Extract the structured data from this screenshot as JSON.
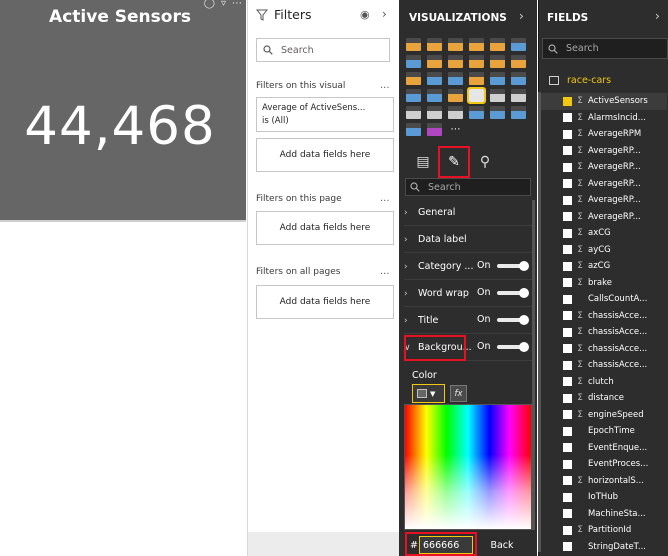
{
  "card": {
    "title": "Active Sensors",
    "value": "44,468",
    "toolbar_icons": [
      "pin-icon",
      "filter-icon",
      "more-icon"
    ]
  },
  "filters": {
    "header": "Filters",
    "search_placeholder": "Search",
    "visual_section": "Filters on this visual",
    "filter_card_line1": "Average of ActiveSens...",
    "filter_card_line2": "is (All)",
    "add_fields": "Add data fields here",
    "page_section": "Filters on this page",
    "all_section": "Filters on all pages",
    "more": "..."
  },
  "visualizations": {
    "header": "VISUALIZATIONS",
    "search_placeholder": "Search",
    "rows": [
      {
        "label": "General",
        "toggle": false
      },
      {
        "label": "Data label",
        "toggle": false
      },
      {
        "label": "Category ...",
        "toggle": true
      },
      {
        "label": "Word wrap",
        "toggle": true
      },
      {
        "label": "Title",
        "toggle": true
      },
      {
        "label": "Backgrou...",
        "toggle": true,
        "expanded": true
      }
    ],
    "on_label": "On",
    "color_label": "Color",
    "fx_label": "fx",
    "hex_value": "666666",
    "hash": "#",
    "back_label": "Back",
    "selected_color": "#666666"
  },
  "fields": {
    "header": "FIELDS",
    "search_placeholder": "Search",
    "table": "race-cars",
    "items": [
      {
        "name": "ActiveSensors",
        "checked": true,
        "sigma": true
      },
      {
        "name": "AlarmsIncid...",
        "checked": false,
        "sigma": true
      },
      {
        "name": "AverageRPM",
        "checked": false,
        "sigma": true
      },
      {
        "name": "AverageRP...",
        "checked": false,
        "sigma": true
      },
      {
        "name": "AverageRP...",
        "checked": false,
        "sigma": true
      },
      {
        "name": "AverageRP...",
        "checked": false,
        "sigma": true
      },
      {
        "name": "AverageRP...",
        "checked": false,
        "sigma": true
      },
      {
        "name": "AverageRP...",
        "checked": false,
        "sigma": true
      },
      {
        "name": "axCG",
        "checked": false,
        "sigma": true
      },
      {
        "name": "ayCG",
        "checked": false,
        "sigma": true
      },
      {
        "name": "azCG",
        "checked": false,
        "sigma": true
      },
      {
        "name": "brake",
        "checked": false,
        "sigma": true
      },
      {
        "name": "CallsCountA...",
        "checked": false,
        "sigma": false
      },
      {
        "name": "chassisAcce...",
        "checked": false,
        "sigma": true
      },
      {
        "name": "chassisAcce...",
        "checked": false,
        "sigma": true
      },
      {
        "name": "chassisAcce...",
        "checked": false,
        "sigma": true
      },
      {
        "name": "chassisAcce...",
        "checked": false,
        "sigma": true
      },
      {
        "name": "clutch",
        "checked": false,
        "sigma": true
      },
      {
        "name": "distance",
        "checked": false,
        "sigma": true
      },
      {
        "name": "engineSpeed",
        "checked": false,
        "sigma": true
      },
      {
        "name": "EpochTime",
        "checked": false,
        "sigma": false
      },
      {
        "name": "EventEnque...",
        "checked": false,
        "sigma": false
      },
      {
        "name": "EventProces...",
        "checked": false,
        "sigma": false
      },
      {
        "name": "horizontalS...",
        "checked": false,
        "sigma": true
      },
      {
        "name": "IoTHub",
        "checked": false,
        "sigma": false
      },
      {
        "name": "MachineSta...",
        "checked": false,
        "sigma": false
      },
      {
        "name": "PartitionId",
        "checked": false,
        "sigma": true
      },
      {
        "name": "StringDateT...",
        "checked": false,
        "sigma": false
      }
    ]
  },
  "colors": {
    "accent_yellow": "#f2c811",
    "highlight_red": "#e81123",
    "pane_dark": "#2d2d2d",
    "card_bg": "#666666"
  }
}
